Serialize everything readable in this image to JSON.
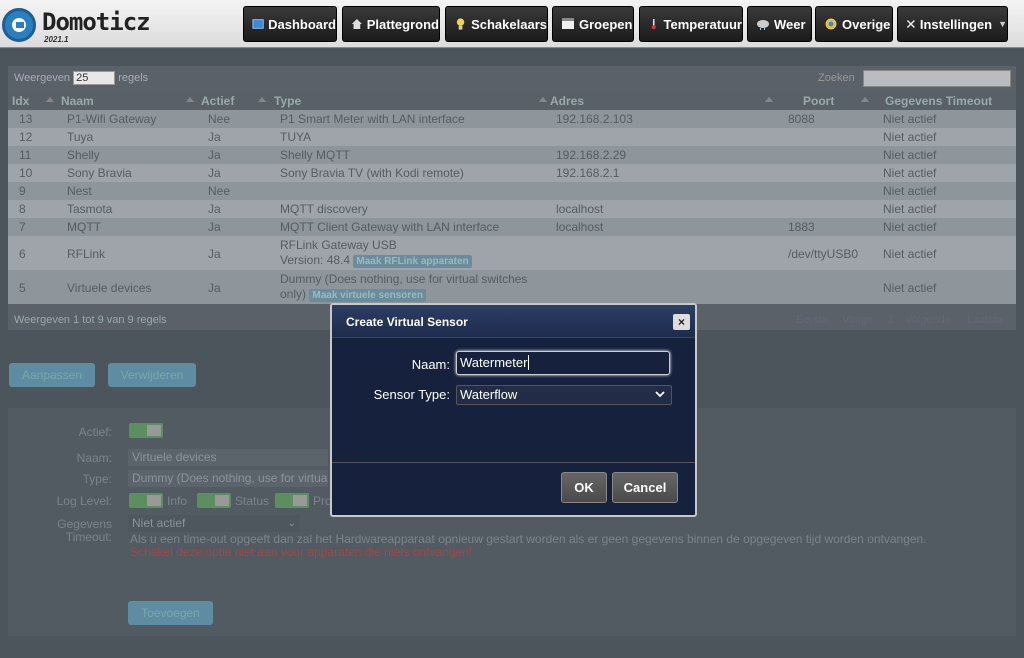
{
  "app": {
    "name": "Domoticz",
    "version": "2021.1"
  },
  "nav": {
    "dashboard": "Dashboard",
    "plattegrond": "Plattegrond",
    "schakelaars": "Schakelaars",
    "groepen": "Groepen",
    "temperatuur": "Temperatuur",
    "weer": "Weer",
    "overige": "Overige",
    "instellingen": "Instellingen"
  },
  "table": {
    "show_prefix": "Weergeven",
    "show_count": "25",
    "show_suffix": "regels",
    "search_label": "Zoeken",
    "headers": [
      "Idx",
      "Naam",
      "Actief",
      "Type",
      "Adres",
      "Poort",
      "Gegevens Timeout"
    ],
    "rows": [
      {
        "idx": "13",
        "naam": "P1-Wifi Gateway",
        "actief": "Nee",
        "type": "P1 Smart Meter with LAN interface",
        "adres": "192.168.2.103",
        "poort": "8088",
        "timeout": "Niet actief"
      },
      {
        "idx": "12",
        "naam": "Tuya",
        "actief": "Ja",
        "type": "TUYA",
        "adres": "",
        "poort": "",
        "timeout": "Niet actief"
      },
      {
        "idx": "11",
        "naam": "Shelly",
        "actief": "Ja",
        "type": "Shelly MQTT",
        "adres": "192.168.2.29",
        "poort": "",
        "timeout": "Niet actief"
      },
      {
        "idx": "10",
        "naam": "Sony Bravia",
        "actief": "Ja",
        "type": "Sony Bravia TV (with Kodi remote)",
        "adres": "192.168.2.1",
        "poort": "",
        "timeout": "Niet actief"
      },
      {
        "idx": "9",
        "naam": "Nest",
        "actief": "Nee",
        "type": "",
        "adres": "",
        "poort": "",
        "timeout": "Niet actief"
      },
      {
        "idx": "8",
        "naam": "Tasmota",
        "actief": "Ja",
        "type": "MQTT discovery",
        "adres": "localhost",
        "poort": "",
        "timeout": "Niet actief"
      },
      {
        "idx": "7",
        "naam": "MQTT",
        "actief": "Ja",
        "type": "MQTT Client Gateway with LAN interface",
        "adres": "localhost",
        "poort": "1883",
        "timeout": "Niet actief"
      },
      {
        "idx": "6",
        "naam": "RFLink",
        "actief": "Ja",
        "type_line1": "RFLink Gateway USB",
        "type_line2": "Version: 48.4",
        "badge": "Maak RFLink apparaten",
        "adres": "",
        "poort": "/dev/ttyUSB0",
        "timeout": "Niet actief"
      },
      {
        "idx": "5",
        "naam": "Virtuele devices",
        "actief": "Ja",
        "type_line1": "Dummy (Does nothing, use for virtual switches",
        "type_line2": "only)",
        "badge": "Maak virtuele sensoren",
        "adres": "",
        "poort": "",
        "timeout": "Niet actief"
      }
    ],
    "footer": "Weergeven 1 tot 9 van 9 regels",
    "pager": {
      "first": "Eerste",
      "prev": "Vorige",
      "page": "1",
      "next": "Volgende",
      "last": "Laatste"
    }
  },
  "actions": {
    "edit": "Aanpassen",
    "delete": "Verwijderen",
    "add": "Toevoegen"
  },
  "form": {
    "actief_label": "Actief:",
    "naam_label": "Naam:",
    "naam_value": "Virtuele devices",
    "type_label": "Type:",
    "type_value": "Dummy (Does nothing, use for virtual s",
    "loglevel_label": "Log Level:",
    "log_info": "Info",
    "log_status": "Status",
    "log_pro": "Pro",
    "timeout_label_1": "Gegevens",
    "timeout_label_2": "Timeout:",
    "timeout_value": "Niet actief",
    "timeout_help": "Als u een time-out opgeeft dan zal het Hardwareapparaat opnieuw gestart worden als er geen gegevens binnen de opgegeven tijd worden ontvangen.",
    "timeout_warning": "Schakel deze optie niet aan voor apparaten die niets ontvangen!"
  },
  "modal": {
    "title": "Create Virtual Sensor",
    "close": "×",
    "name_label": "Naam:",
    "name_value": "Watermeter",
    "type_label": "Sensor Type:",
    "type_value": "Waterflow",
    "ok": "OK",
    "cancel": "Cancel"
  },
  "colors": {
    "modal_bg": "#15213d",
    "header_bg": "#e8e8e8",
    "nav_bg": "#262626",
    "overlay": "#4c545c"
  }
}
